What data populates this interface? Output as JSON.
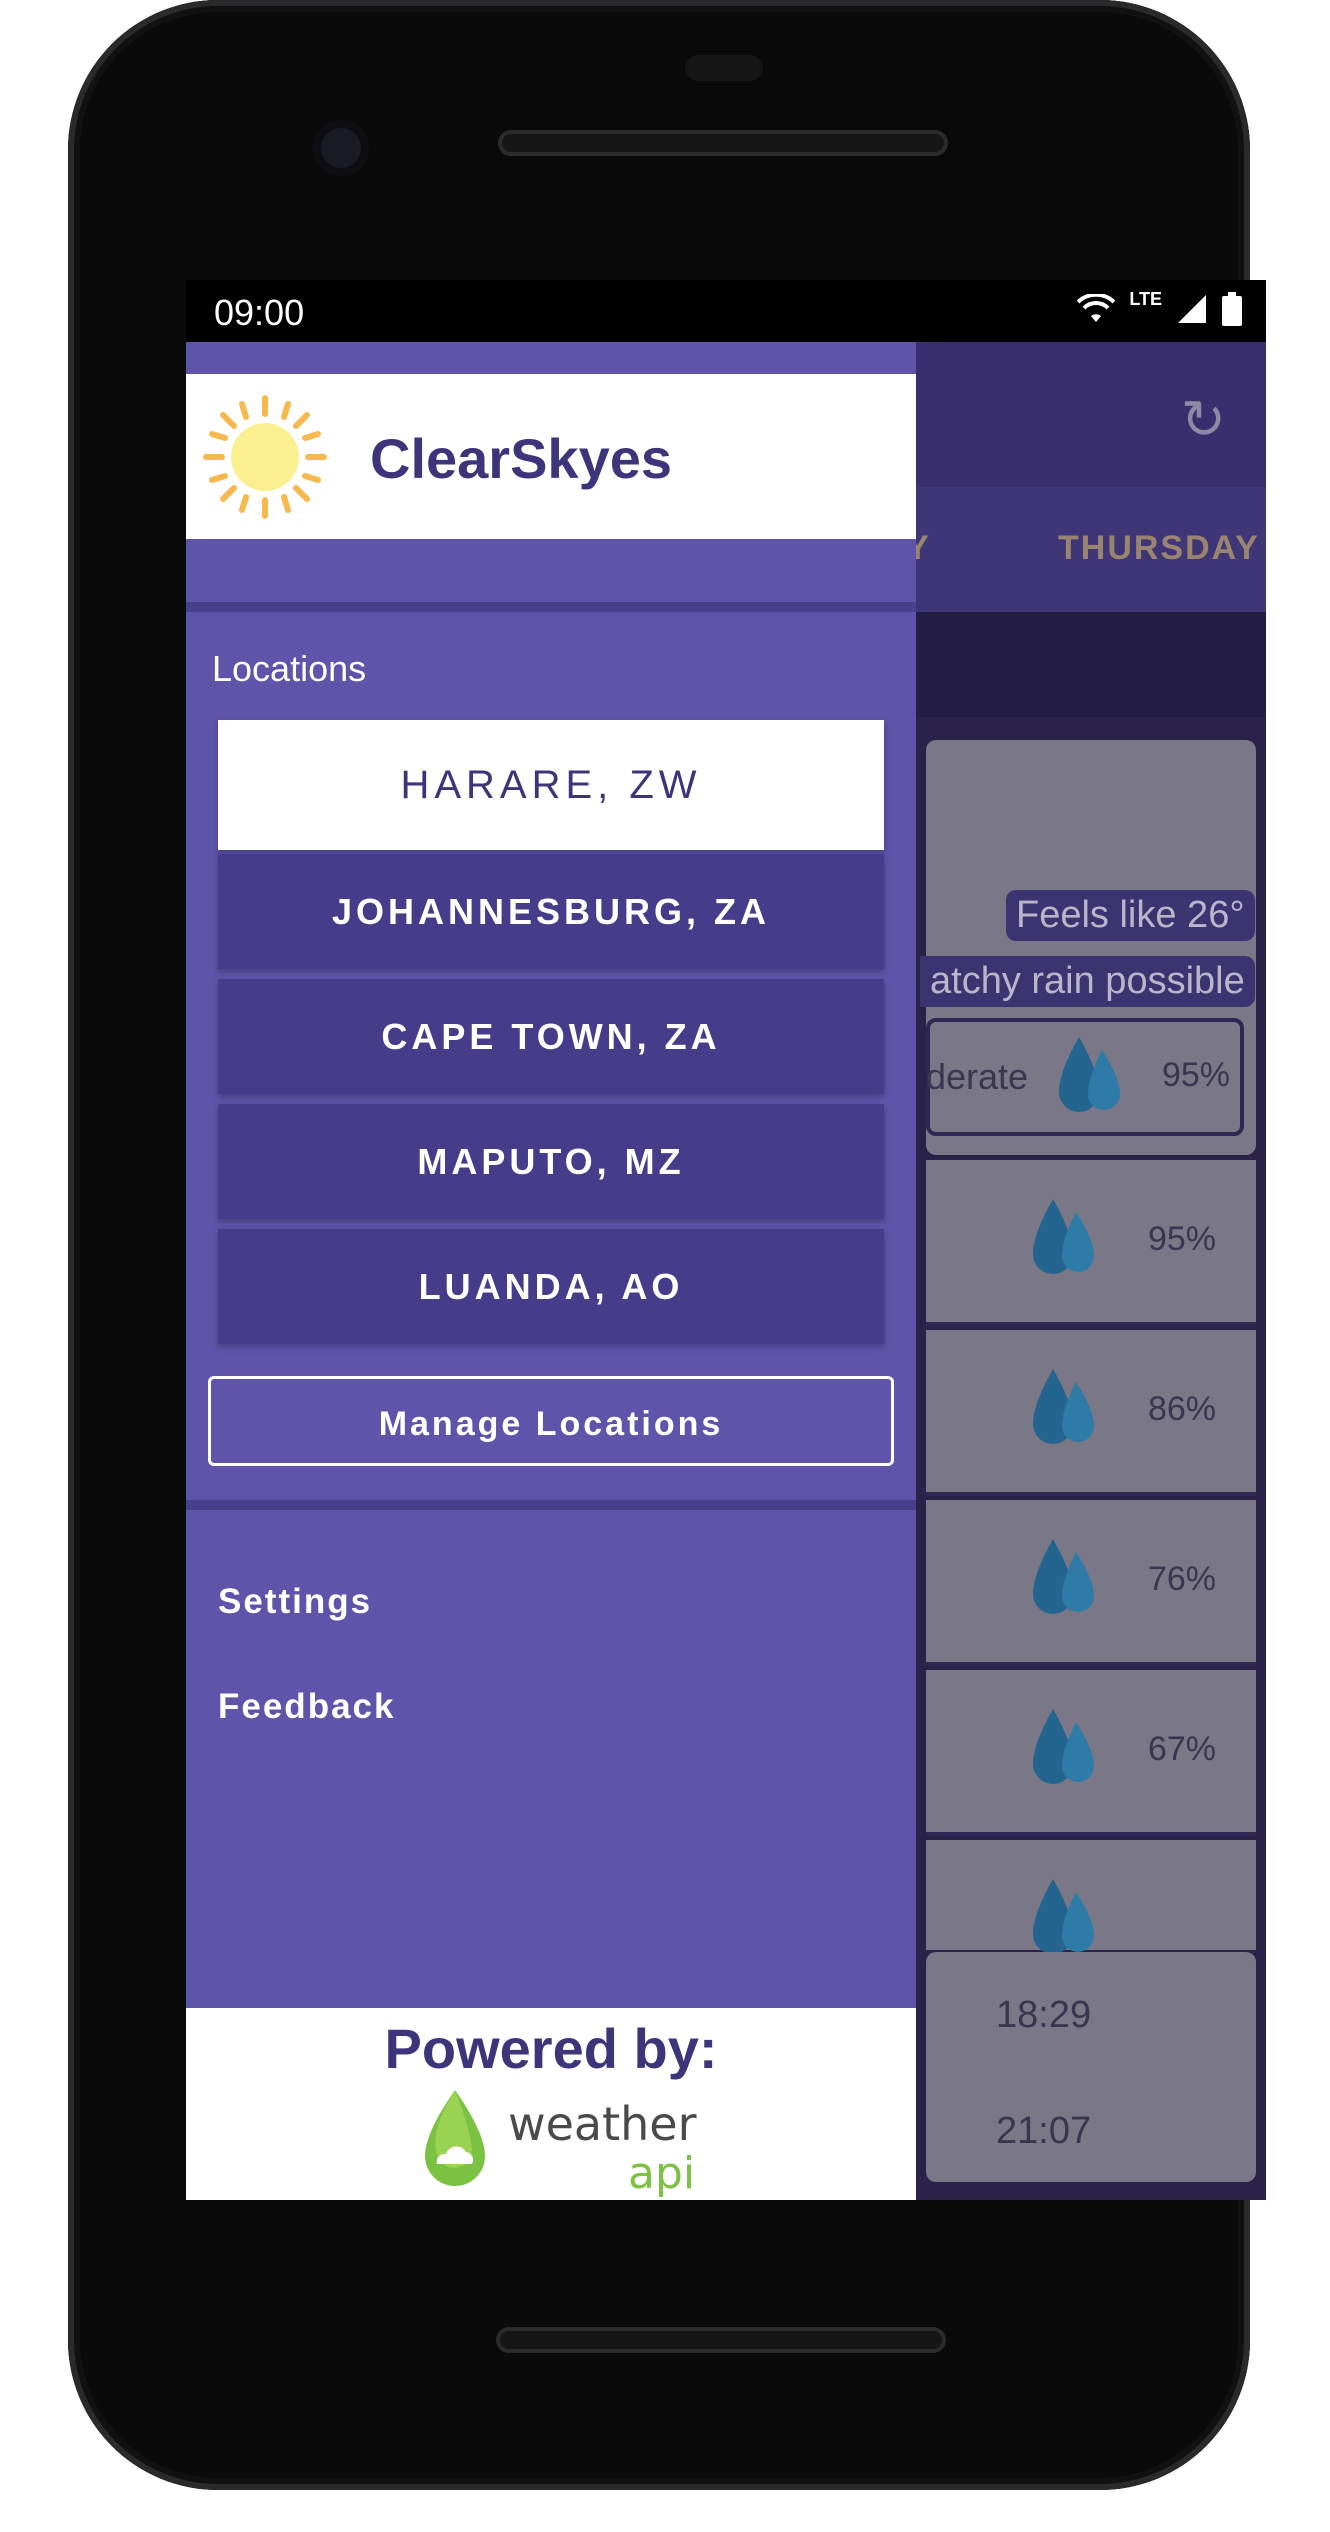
{
  "status_bar": {
    "time": "09:00",
    "network": "LTE"
  },
  "background_app": {
    "tab_partial": "Y",
    "tab_visible": "THURSDAY",
    "feels_like": "Feels like 26°",
    "condition": "atchy rain possible",
    "intensity": "derate",
    "current_humidity": "95%",
    "hourly_humidity": [
      "95%",
      "86%",
      "76%",
      "67%"
    ],
    "sunset": "18:29",
    "moonrise": "21:07"
  },
  "drawer": {
    "app_name": "ClearSkyes",
    "locations_label": "Locations",
    "locations": [
      {
        "label": "HARARE, ZW",
        "active": true
      },
      {
        "label": "JOHANNESBURG, ZA",
        "active": false
      },
      {
        "label": "CAPE TOWN, ZA",
        "active": false
      },
      {
        "label": "MAPUTO, MZ",
        "active": false
      },
      {
        "label": "LUANDA, AO",
        "active": false
      }
    ],
    "manage_label": "Manage Locations",
    "menu": {
      "settings": "Settings",
      "feedback": "Feedback"
    },
    "footer": {
      "powered_by": "Powered by:",
      "logo_word_1": "weather",
      "logo_word_2": "api"
    }
  },
  "colors": {
    "drawer": "#5e54a9",
    "primary_dark": "#3d357a",
    "location_button": "#463d8a",
    "logo_green": "#7cc242"
  }
}
